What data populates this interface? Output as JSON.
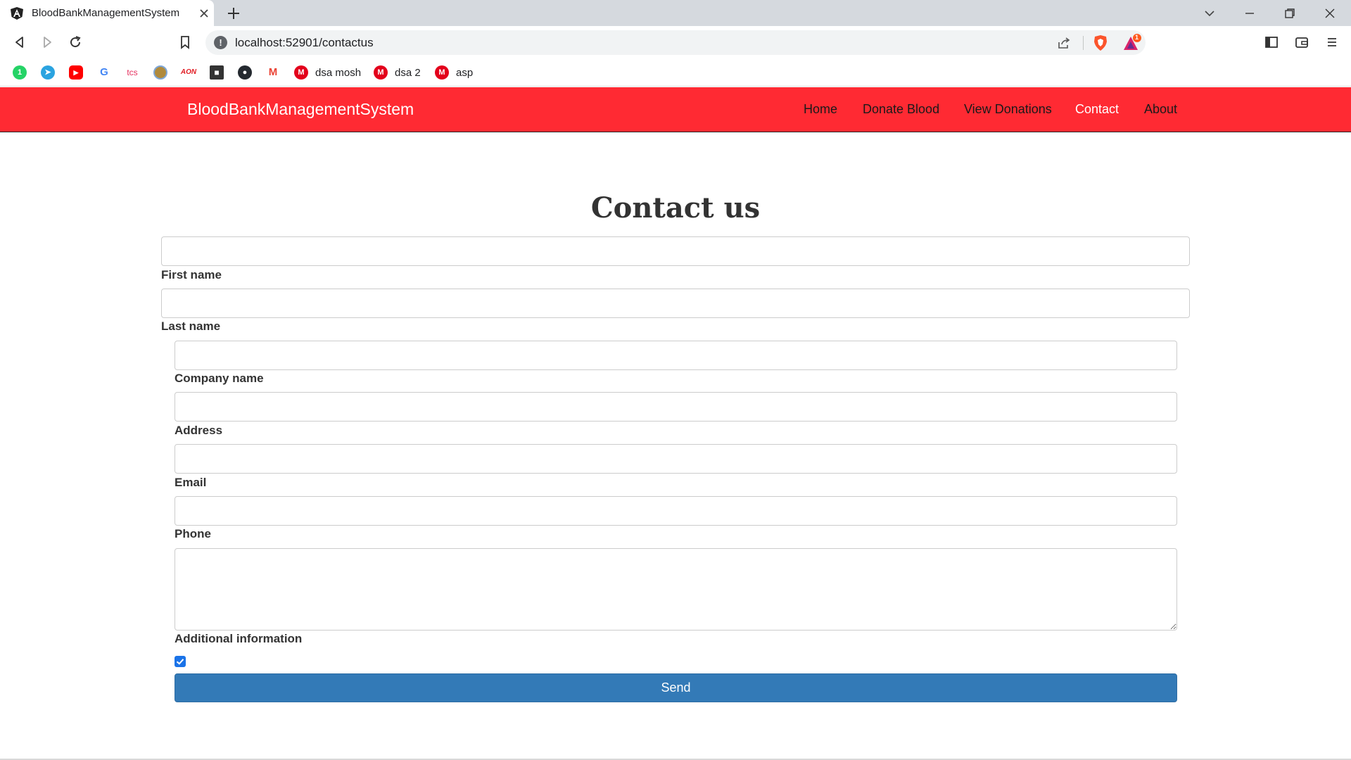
{
  "browser": {
    "tab_title": "BloodBankManagementSystem",
    "url": "localhost:52901/contactus",
    "rewards_badge": "1",
    "bookmarks": [
      {
        "label": "",
        "icon": "whatsapp-icon",
        "color": "#25d366"
      },
      {
        "label": "",
        "icon": "telegram-icon",
        "color": "#2aa3e0"
      },
      {
        "label": "",
        "icon": "youtube-icon",
        "color": "#ff0000"
      },
      {
        "label": "",
        "icon": "google-icon",
        "color": "#4285f4"
      },
      {
        "label": "",
        "icon": "tcs-icon",
        "color": "#e5305e"
      },
      {
        "label": "",
        "icon": "emblem-icon",
        "color": "#b08a3c"
      },
      {
        "label": "",
        "icon": "aon-icon",
        "color": "#e11b22"
      },
      {
        "label": "",
        "icon": "contacts-icon",
        "color": "#333333"
      },
      {
        "label": "",
        "icon": "github-icon",
        "color": "#24292f"
      },
      {
        "label": "",
        "icon": "gmail-icon",
        "color": "#ea4335"
      },
      {
        "label": "dsa mosh",
        "icon": "mosh-icon",
        "color": "#e3001b"
      },
      {
        "label": "dsa 2",
        "icon": "mosh-icon",
        "color": "#e3001b"
      },
      {
        "label": "asp",
        "icon": "mosh-icon",
        "color": "#e3001b"
      }
    ]
  },
  "navbar": {
    "brand": "BloodBankManagementSystem",
    "links": [
      "Home",
      "Donate Blood",
      "View Donations",
      "Contact",
      "About"
    ],
    "active": "Contact"
  },
  "form": {
    "title": "Contact us",
    "labels": {
      "first_name": "First name",
      "last_name": "Last name",
      "company_name": "Company name",
      "address": "Address",
      "email": "Email",
      "phone": "Phone",
      "additional_info": "Additional information"
    },
    "checkbox_checked": true,
    "send_label": "Send"
  },
  "colors": {
    "navbar": "#ff2a33",
    "button": "#337ab7"
  }
}
